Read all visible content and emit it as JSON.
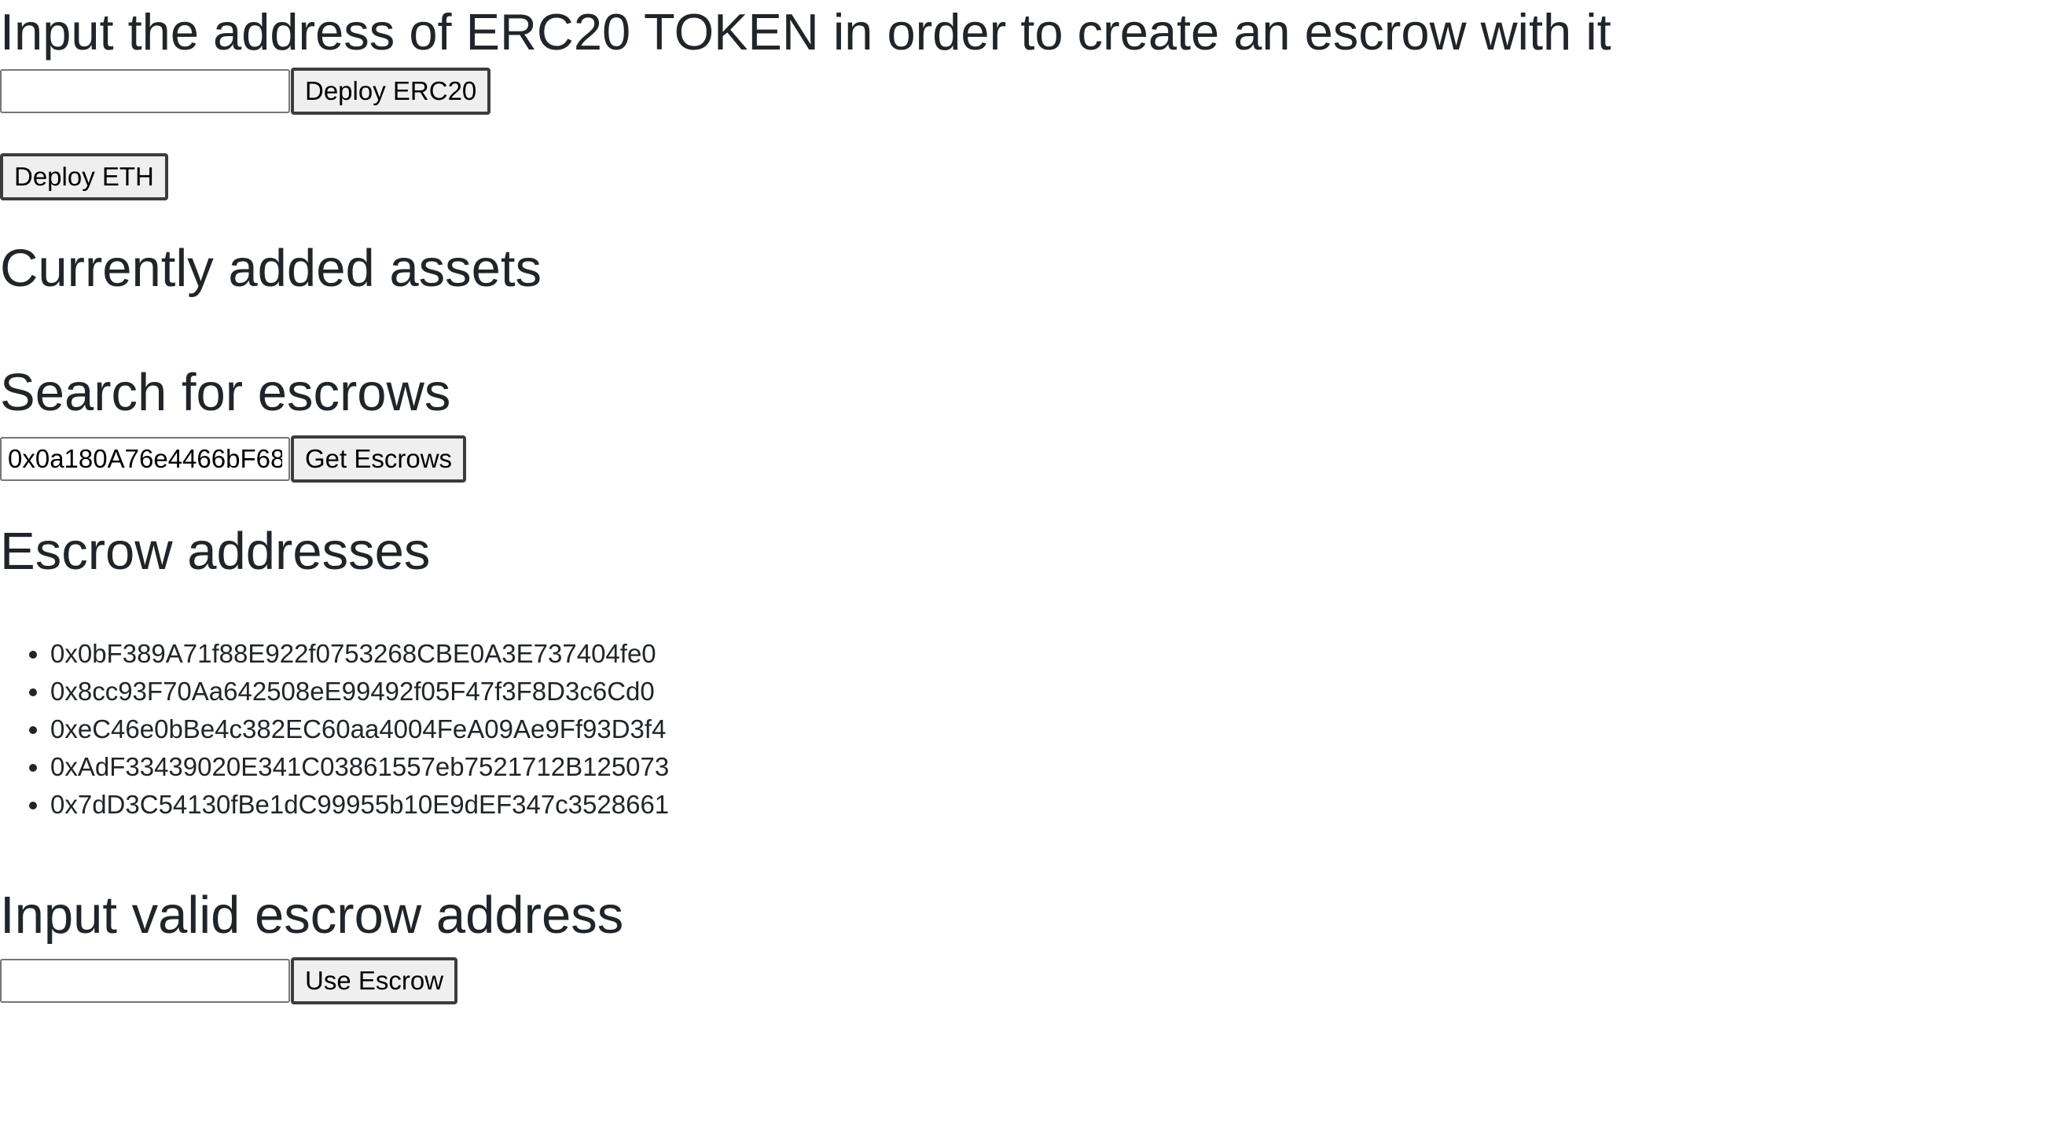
{
  "erc20_section": {
    "heading": "Input the address of ERC20 TOKEN in order to create an escrow with it",
    "token_input_value": "",
    "deploy_erc20_label": "Deploy ERC20"
  },
  "eth_section": {
    "deploy_eth_label": "Deploy ETH"
  },
  "assets_section": {
    "heading": "Currently added assets"
  },
  "search_section": {
    "heading": "Search for escrows",
    "search_input_value": "0x0a180A76e4466bF68",
    "get_escrows_label": "Get Escrows"
  },
  "escrow_list": {
    "heading": "Escrow addresses",
    "items": [
      "0x0bF389A71f88E922f0753268CBE0A3E737404fe0",
      "0x8cc93F70Aa642508eE99492f05F47f3F8D3c6Cd0",
      "0xeC46e0bBe4c382EC60aa4004FeA09Ae9Ff93D3f4",
      "0xAdF33439020E341C03861557eb7521712B125073",
      "0x7dD3C54130fBe1dC99955b10E9dEF347c3528661"
    ]
  },
  "use_section": {
    "heading": "Input valid escrow address",
    "escrow_input_value": "",
    "use_escrow_label": "Use Escrow"
  }
}
